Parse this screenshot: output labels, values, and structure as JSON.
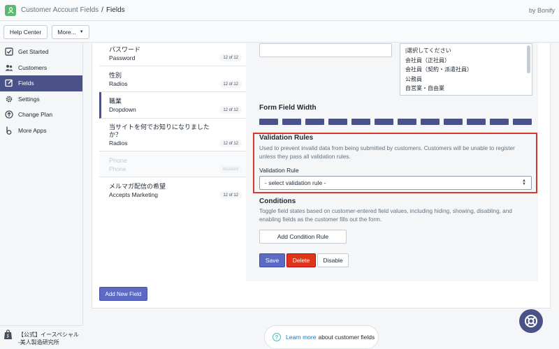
{
  "header": {
    "app_title": "Customer Account Fields",
    "separator": "/",
    "page": "Fields",
    "by": "by Bonify"
  },
  "toolbar": {
    "help_label": "Help Center",
    "more_label": "More..."
  },
  "sidebar": {
    "items": [
      {
        "label": "Get Started",
        "icon": "checkbox-icon"
      },
      {
        "label": "Customers",
        "icon": "people-icon"
      },
      {
        "label": "Fields",
        "icon": "edit-icon",
        "active": true
      },
      {
        "label": "Settings",
        "icon": "gear-icon"
      },
      {
        "label": "Change Plan",
        "icon": "arrow-up-circle-icon"
      },
      {
        "label": "More Apps",
        "icon": "bonify-icon"
      }
    ],
    "store_name": "【公式】イースペシャル -美人製造研究所"
  },
  "fields": [
    {
      "title": "パスワード",
      "type": "Password",
      "badge": "12 of 12"
    },
    {
      "title": "性別",
      "type": "Radios",
      "badge": "12 of 12"
    },
    {
      "title": "職業",
      "type": "Dropdown",
      "badge": "12 of 12",
      "selected": true
    },
    {
      "title": "当サイトを何でお知りになりましたか？",
      "type": "Radios",
      "badge": "12 of 12"
    },
    {
      "title": "Phone",
      "type": "Phone",
      "badge": "disabled",
      "disabled": true
    },
    {
      "title": "メルマガ配信の希望",
      "type": "Accepts Marketing",
      "badge": "12 of 12"
    }
  ],
  "editor": {
    "options": [
      "|選択してください",
      "会社員（正社員）",
      "会社員（契約・派遣社員）",
      "公務員",
      "自営業・自由業"
    ],
    "width_title": "Form Field Width",
    "width_segments": 12,
    "validation_title": "Validation Rules",
    "validation_desc": "Used to prevent invalid data from being submitted by customers. Customers will be unable to register unless they pass all validation rules.",
    "validation_label": "Validation Rule",
    "validation_select": "- select validation rule -",
    "conditions_title": "Conditions",
    "conditions_desc": "Toggle field states based on customer-entered field values, including hiding, showing, disabling, and enabling fields as the customer fills out the form.",
    "add_condition": "Add Condition Rule",
    "save": "Save",
    "delete": "Delete",
    "disable": "Disable"
  },
  "add_field_label": "Add New Field",
  "learn": {
    "icon_glyph": "?",
    "link": "Learn more",
    "text": "about customer fields"
  },
  "colors": {
    "accent": "#4b5288",
    "primary_button": "#5c6ac4",
    "danger": "#de3618",
    "highlight_box": "#d9392b"
  }
}
